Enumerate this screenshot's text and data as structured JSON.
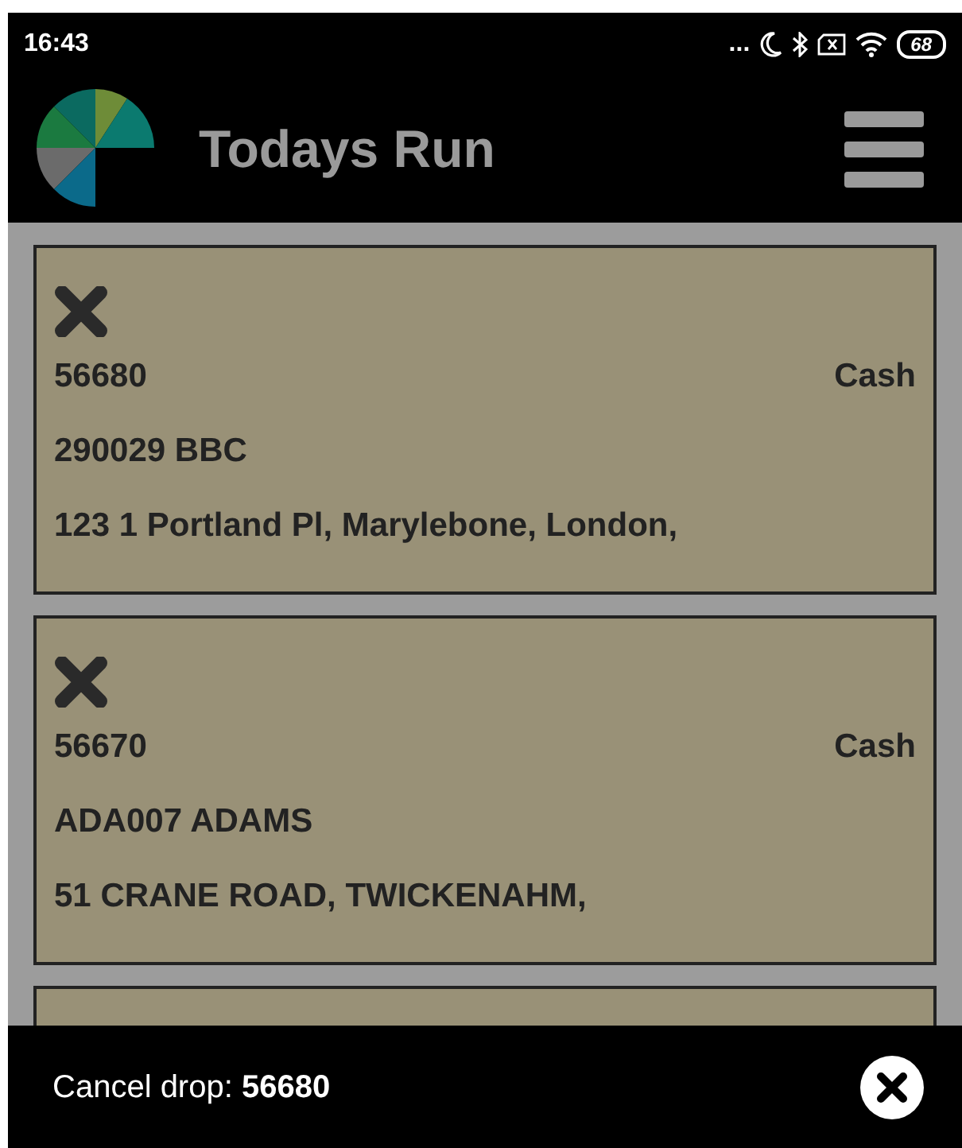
{
  "status_bar": {
    "time": "16:43",
    "more": "...",
    "battery": "68"
  },
  "header": {
    "title": "Todays Run"
  },
  "drops": [
    {
      "kind": "full",
      "number": "56680",
      "payment": "Cash",
      "customer": "290029 BBC",
      "address": "123 1 Portland Pl, Marylebone, London,"
    },
    {
      "kind": "full",
      "number": "56670",
      "payment": "Cash",
      "customer": "ADA007 ADAMS",
      "address": "51 CRANE ROAD, TWICKENAHM,"
    },
    {
      "kind": "partial"
    }
  ],
  "snackbar": {
    "message": "Cancel drop: **56680**"
  }
}
